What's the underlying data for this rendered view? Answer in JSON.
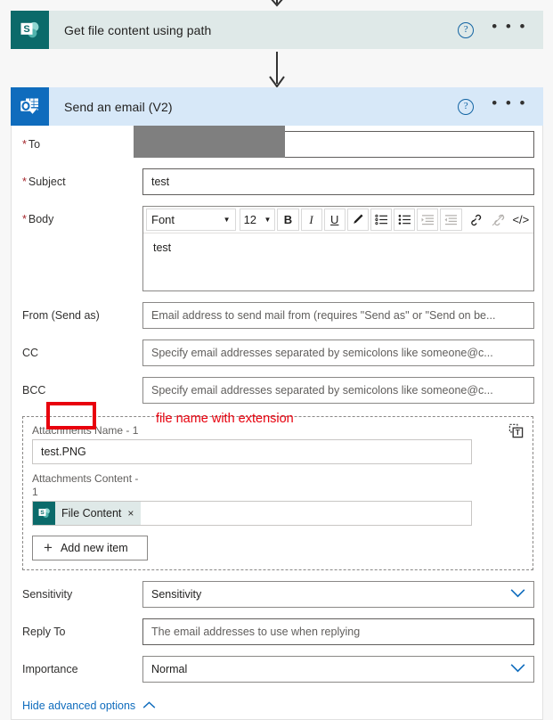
{
  "flow": {
    "steps": [
      {
        "id": "get-file-content",
        "title": "Get file content using path",
        "connector": "sharepoint",
        "help_label": "?",
        "menu_label": "• • •"
      },
      {
        "id": "send-email-v2",
        "title": "Send an email (V2)",
        "connector": "outlook",
        "help_label": "?",
        "menu_label": "• • •"
      }
    ]
  },
  "email_form": {
    "to": {
      "label": "To",
      "required": true,
      "value": "",
      "redacted": true
    },
    "subject": {
      "label": "Subject",
      "required": true,
      "value": "test"
    },
    "body": {
      "label": "Body",
      "required": true,
      "value": "test",
      "toolbar": {
        "font_label": "Font",
        "size_label": "12",
        "bold_label": "B",
        "italic_label": "I",
        "underline_label": "U",
        "highlight_label": "highlight-pen-icon",
        "numbered_list_label": "numbered-list-icon",
        "bulleted_list_label": "bulleted-list-icon",
        "indent_label": "indent-icon",
        "outdent_label": "outdent-icon",
        "link_label": "link-icon",
        "unlink_label": "unlink-icon",
        "code_label": "</>"
      }
    },
    "from": {
      "label": "From (Send as)",
      "placeholder": "Email address to send mail from (requires \"Send as\" or \"Send on be..."
    },
    "cc": {
      "label": "CC",
      "placeholder": "Specify email addresses separated by semicolons like someone@c..."
    },
    "bcc": {
      "label": "BCC",
      "placeholder": "Specify email addresses separated by semicolons like someone@c..."
    },
    "attachments": {
      "name_label": "Attachments Name - 1",
      "name_value": "test.PNG",
      "content_label": "Attachments Content - 1",
      "content_token": "File Content",
      "content_token_remove": "×",
      "add_button": "Add new item",
      "add_button_icon": "plus-icon",
      "copy_icon": "dynamic-content-token-icon"
    },
    "sensitivity": {
      "label": "Sensitivity",
      "placeholder": "Sensitivity"
    },
    "reply_to": {
      "label": "Reply To",
      "placeholder": "The email addresses to use when replying"
    },
    "importance": {
      "label": "Importance",
      "value": "Normal"
    },
    "advanced_toggle": {
      "label": "Hide advanced options",
      "icon": "chevron-up-icon"
    }
  },
  "annotations": {
    "file_name_note": "file name with extension",
    "highlight_color": "#e8000d",
    "redaction_color": "#7f7f7f"
  },
  "colors": {
    "sharepoint_teal": "#0b6a6a",
    "sharepoint_header": "#dfe9e8",
    "outlook_blue": "#0f6cbd",
    "outlook_header": "#d7e8f8",
    "link_blue": "#0f6cbd",
    "required_red": "#a4262c",
    "page_background": "#f7f7f7"
  }
}
